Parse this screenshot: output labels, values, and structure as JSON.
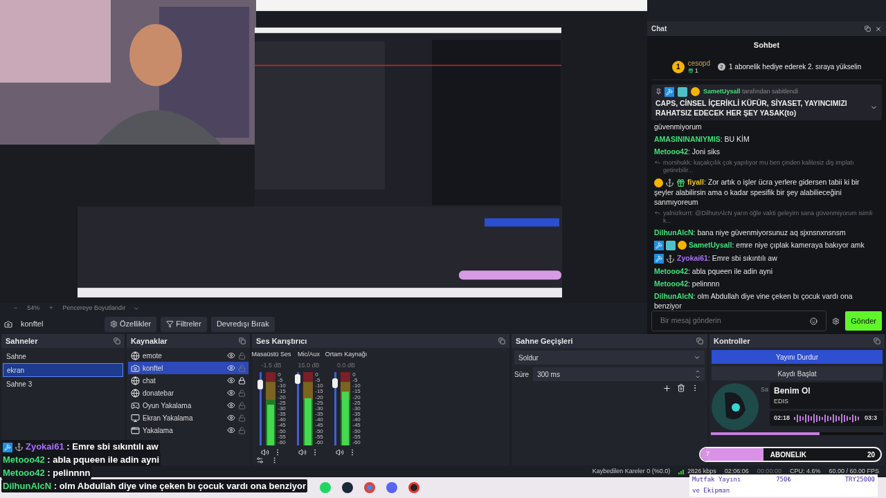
{
  "zoom_bar": {
    "minus": "−",
    "value": "54%",
    "plus": "+",
    "fit": "Pencereye Boyutlandır"
  },
  "source_toolbar": {
    "source": "konftel",
    "buttons": [
      "Özellikler",
      "Filtreler",
      "Devredışı Bırak"
    ]
  },
  "chat": {
    "dock_title": "Chat",
    "title": "Sohbet",
    "leader": {
      "rank": "1",
      "user": "cesopd",
      "gifts": "1",
      "next_rank": "2",
      "prompt": "1 abonelik hediye ederek 2. sıraya yükselin"
    },
    "pinned": {
      "badges": [
        {
          "kind": "mod"
        },
        {
          "kind": "vip"
        },
        {
          "kind": "sub"
        }
      ],
      "user": "SametUysall",
      "by": "tarafından sabitlendi",
      "text": "CAPS, CİNSEL İÇERİKLİ KÜFÜR, SİYASET, YAYINCIMIZI RAHATSIZ EDECEK HER ŞEY YASAK(to)"
    },
    "messages": [
      {
        "kind": "text",
        "text": "güvenmiyorum"
      },
      {
        "kind": "message",
        "user": "AMASININANIYMIS",
        "color": "#3ee27a",
        "text": ": BU KİM"
      },
      {
        "kind": "message",
        "user": "Metooo42",
        "color": "#3ee27a",
        "text": ": Joni siks"
      },
      {
        "kind": "reply",
        "text": "morshukk: kaçakçılık çok yapılıyor mu ben çinden kalitesiz diş implatı getirebilir..."
      },
      {
        "kind": "message",
        "badges": [
          {
            "kind": "sub"
          },
          {
            "kind": "anchor"
          },
          {
            "kind": "gift"
          }
        ],
        "user": "fiyall",
        "color": "#f5c518",
        "text": ": Zor artık o işler ücra yerlere gidersen tabii ki bir şeyler alabilirsin ama o kadar spesifik bir şey alabilieceğini sanmıyoreum"
      },
      {
        "kind": "reply",
        "text": "yalnizkurrt: @DilhunAlcN yarın öğle vakti geleyim sana güvenmiyorum isimli k..."
      },
      {
        "kind": "message",
        "user": "DilhunAlcN",
        "color": "#3ee27a",
        "text": ": bana niye güvenmiyorsunuz aq sjxnsnxnsnsm"
      },
      {
        "kind": "message",
        "badges": [
          {
            "kind": "mod"
          },
          {
            "kind": "vip"
          },
          {
            "kind": "sub"
          }
        ],
        "user": "SametUysall",
        "color": "#3ee27a",
        "text": ": emre niye çıplak kameraya bakıyor amk"
      },
      {
        "kind": "message",
        "badges": [
          {
            "kind": "mod"
          },
          {
            "kind": "anchor"
          }
        ],
        "user": "Zyokai61",
        "color": "#a970ff",
        "text": ": Emre sbi sıkıntılı aw"
      },
      {
        "kind": "message",
        "user": "Metooo42",
        "color": "#3ee27a",
        "text": ": abla pqueen ile adin ayni"
      },
      {
        "kind": "message",
        "user": "Metooo42",
        "color": "#3ee27a",
        "text": ": pelinnnn"
      },
      {
        "kind": "message",
        "user": "DilhunAlcN",
        "color": "#3ee27a",
        "text": ": olm Abdullah diye vine çeken bı çocuk vardı ona benziyor"
      }
    ],
    "input": {
      "placeholder": "Bir mesaj gönderin"
    },
    "send": "Gönder"
  },
  "scenes": {
    "title": "Sahneler",
    "items": [
      {
        "name": "Sahne",
        "selected": false
      },
      {
        "name": "ekran",
        "selected": true
      },
      {
        "name": "Sahne 3",
        "selected": false
      }
    ]
  },
  "sources": {
    "title": "Kaynaklar",
    "items": [
      {
        "kind": "browser",
        "name": "emote",
        "selected": false,
        "locked": false
      },
      {
        "kind": "camera",
        "name": "konftel",
        "selected": true,
        "locked": false
      },
      {
        "kind": "browser",
        "name": "chat",
        "selected": false,
        "locked": true
      },
      {
        "kind": "browser",
        "name": "donatebar",
        "selected": false,
        "locked": false
      },
      {
        "kind": "game",
        "name": "Oyun Yakalama",
        "selected": false,
        "locked": false
      },
      {
        "kind": "display",
        "name": "Ekran Yakalama",
        "selected": false,
        "locked": false
      },
      {
        "kind": "window",
        "name": "Yakalama",
        "selected": false,
        "locked": false
      }
    ]
  },
  "mixer": {
    "title": "Ses Karıştırıcı",
    "channels": [
      {
        "name": "Masaüstü Ses",
        "reading": "-1.5 dB",
        "level": 0.88,
        "scale": [
          "0",
          "-5",
          "-10",
          "-15",
          "-20",
          "-25",
          "-30",
          "-35",
          "-40",
          "-45",
          "-50",
          "-55",
          "-60"
        ]
      },
      {
        "name": "Mic/Aux",
        "reading": "15.0 dB",
        "level": 0.97,
        "scale": [
          "0",
          "-5",
          "-10",
          "-15",
          "-20",
          "-25",
          "-30",
          "-35",
          "-40",
          "-45",
          "-50",
          "-55",
          "-60"
        ]
      },
      {
        "name": "Ortam Kaynağı",
        "reading": "0.0 dB",
        "level": 0.9,
        "scale": [
          "0",
          "-5",
          "-10",
          "-15",
          "-20",
          "-25",
          "-30",
          "-35",
          "-40",
          "-45",
          "-50",
          "-55",
          "-60"
        ]
      }
    ]
  },
  "transitions": {
    "title": "Sahne Geçişleri",
    "type": "Soldur",
    "duration_label": "Süre",
    "duration": "300 ms"
  },
  "controls": {
    "title": "Kontroller",
    "buttons": [
      {
        "label": "Yayını Durdur",
        "selected": true
      },
      {
        "label": "Kaydı Başlat",
        "selected": false
      }
    ],
    "music": {
      "hidden_label": "Sa",
      "title": "Benim Ol",
      "artist": "EDIS",
      "elapsed": "02:18",
      "total": "03:3",
      "level": 0.63
    }
  },
  "sub_goal": {
    "current": "7",
    "label": "ABONELIK",
    "target": "20",
    "level": 0.35
  },
  "overlay_chat": [
    {
      "badges": [
        {
          "kind": "mod"
        },
        {
          "kind": "anchor"
        }
      ],
      "user": "Zyokai61",
      "color": "#a970ff",
      "text": ": Emre sbi sıkıntılı aw"
    },
    {
      "user": "Metooo42",
      "color": "#3ee27a",
      "text": ": abla pqueen ile adin ayni"
    },
    {
      "user": "Metooo42",
      "color": "#3ee27a",
      "text": ": pelinnnn"
    },
    {
      "user": "DilhunAlcN",
      "color": "#3ee27a",
      "text": ": olm Abdullah diye vine çeken bı çocuk vardı ona benziyor"
    }
  ],
  "status_bar": {
    "dropped": "Kaybedilen Kareler 0 (%0.0)",
    "bitrate": "2826 kbps",
    "stream_time": "02:06:06",
    "record_time": "00:00:00",
    "cpu": "CPU: 4.6%",
    "fps": "60.00 / 60.00 FPS"
  },
  "donation": {
    "title_1": "Mutfak Yayını",
    "title_2": "ve Ekipman",
    "amount": "750₺",
    "goal": "TRY25000"
  },
  "taskbar": {
    "apps": [
      {
        "kind": "music"
      },
      {
        "kind": "steam"
      },
      {
        "kind": "browser"
      },
      {
        "kind": "discord"
      },
      {
        "kind": "game"
      }
    ]
  }
}
